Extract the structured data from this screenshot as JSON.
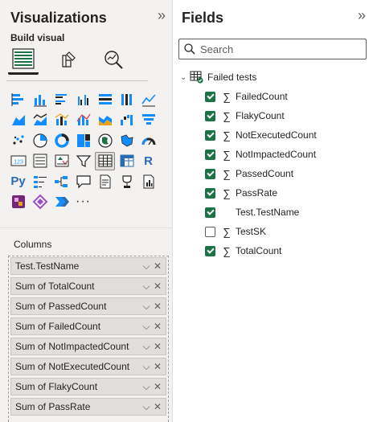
{
  "viz_pane": {
    "title": "Visualizations",
    "collapse_glyph": "»",
    "build_label": "Build visual",
    "modes": [
      {
        "name": "build-visual-icon",
        "active": true
      },
      {
        "name": "format-visual-icon",
        "active": false
      },
      {
        "name": "analytics-icon",
        "active": false
      }
    ],
    "visuals": [
      "stacked-bar-icon",
      "stacked-column-icon",
      "clustered-bar-icon",
      "clustered-column-icon",
      "100-stacked-bar-icon",
      "100-stacked-column-icon",
      "line-chart-icon",
      "area-chart-icon",
      "stacked-area-icon",
      "line-clustered-column-icon",
      "line-stacked-column-icon",
      "ribbon-chart-icon",
      "waterfall-icon",
      "funnel-icon",
      "scatter-icon",
      "pie-chart-icon",
      "donut-chart-icon",
      "treemap-icon",
      "map-icon",
      "filled-map-icon",
      "gauge-icon",
      "card-icon",
      "multi-row-card-icon",
      "kpi-icon",
      "slicer-icon",
      "table-icon",
      "matrix-icon",
      "r-visual-icon",
      "python-visual-icon",
      "key-influencers-icon",
      "decomposition-tree-icon",
      "qa-icon",
      "smart-narrative-icon",
      "metrics-icon",
      "paginated-report-icon",
      "power-apps-icon",
      "power-automate-icon",
      "arrow-icon",
      "more-visuals-icon"
    ],
    "selected_visual_index": 25,
    "r_label": "R",
    "py_label": "Py",
    "more_label": "···",
    "columns_label": "Columns",
    "wells": [
      "Test.TestName",
      "Sum of TotalCount",
      "Sum of PassedCount",
      "Sum of FailedCount",
      "Sum of NotImpactedCount",
      "Sum of NotExecutedCount",
      "Sum of FlakyCount",
      "Sum of PassRate"
    ],
    "well_chevron": "⌵",
    "well_close": "✕"
  },
  "fields_pane": {
    "title": "Fields",
    "collapse_glyph": "»",
    "search_placeholder": "Search",
    "table_name": "Failed tests",
    "fields": [
      {
        "label": "FailedCount",
        "checked": true,
        "sigma": true
      },
      {
        "label": "FlakyCount",
        "checked": true,
        "sigma": true
      },
      {
        "label": "NotExecutedCount",
        "checked": true,
        "sigma": true
      },
      {
        "label": "NotImpactedCount",
        "checked": true,
        "sigma": true
      },
      {
        "label": "PassedCount",
        "checked": true,
        "sigma": true
      },
      {
        "label": "PassRate",
        "checked": true,
        "sigma": true
      },
      {
        "label": "Test.TestName",
        "checked": true,
        "sigma": false
      },
      {
        "label": "TestSK",
        "checked": false,
        "sigma": true
      },
      {
        "label": "TotalCount",
        "checked": true,
        "sigma": true
      }
    ],
    "sigma_glyph": "∑"
  },
  "colors": {
    "accent_green": "#1e7145",
    "pane_bg": "#f3f2f1",
    "icon_blue": "#2b6cb0",
    "icon_teal": "#118dff",
    "icon_yellow": "#e8a317",
    "icon_red": "#d64550"
  }
}
